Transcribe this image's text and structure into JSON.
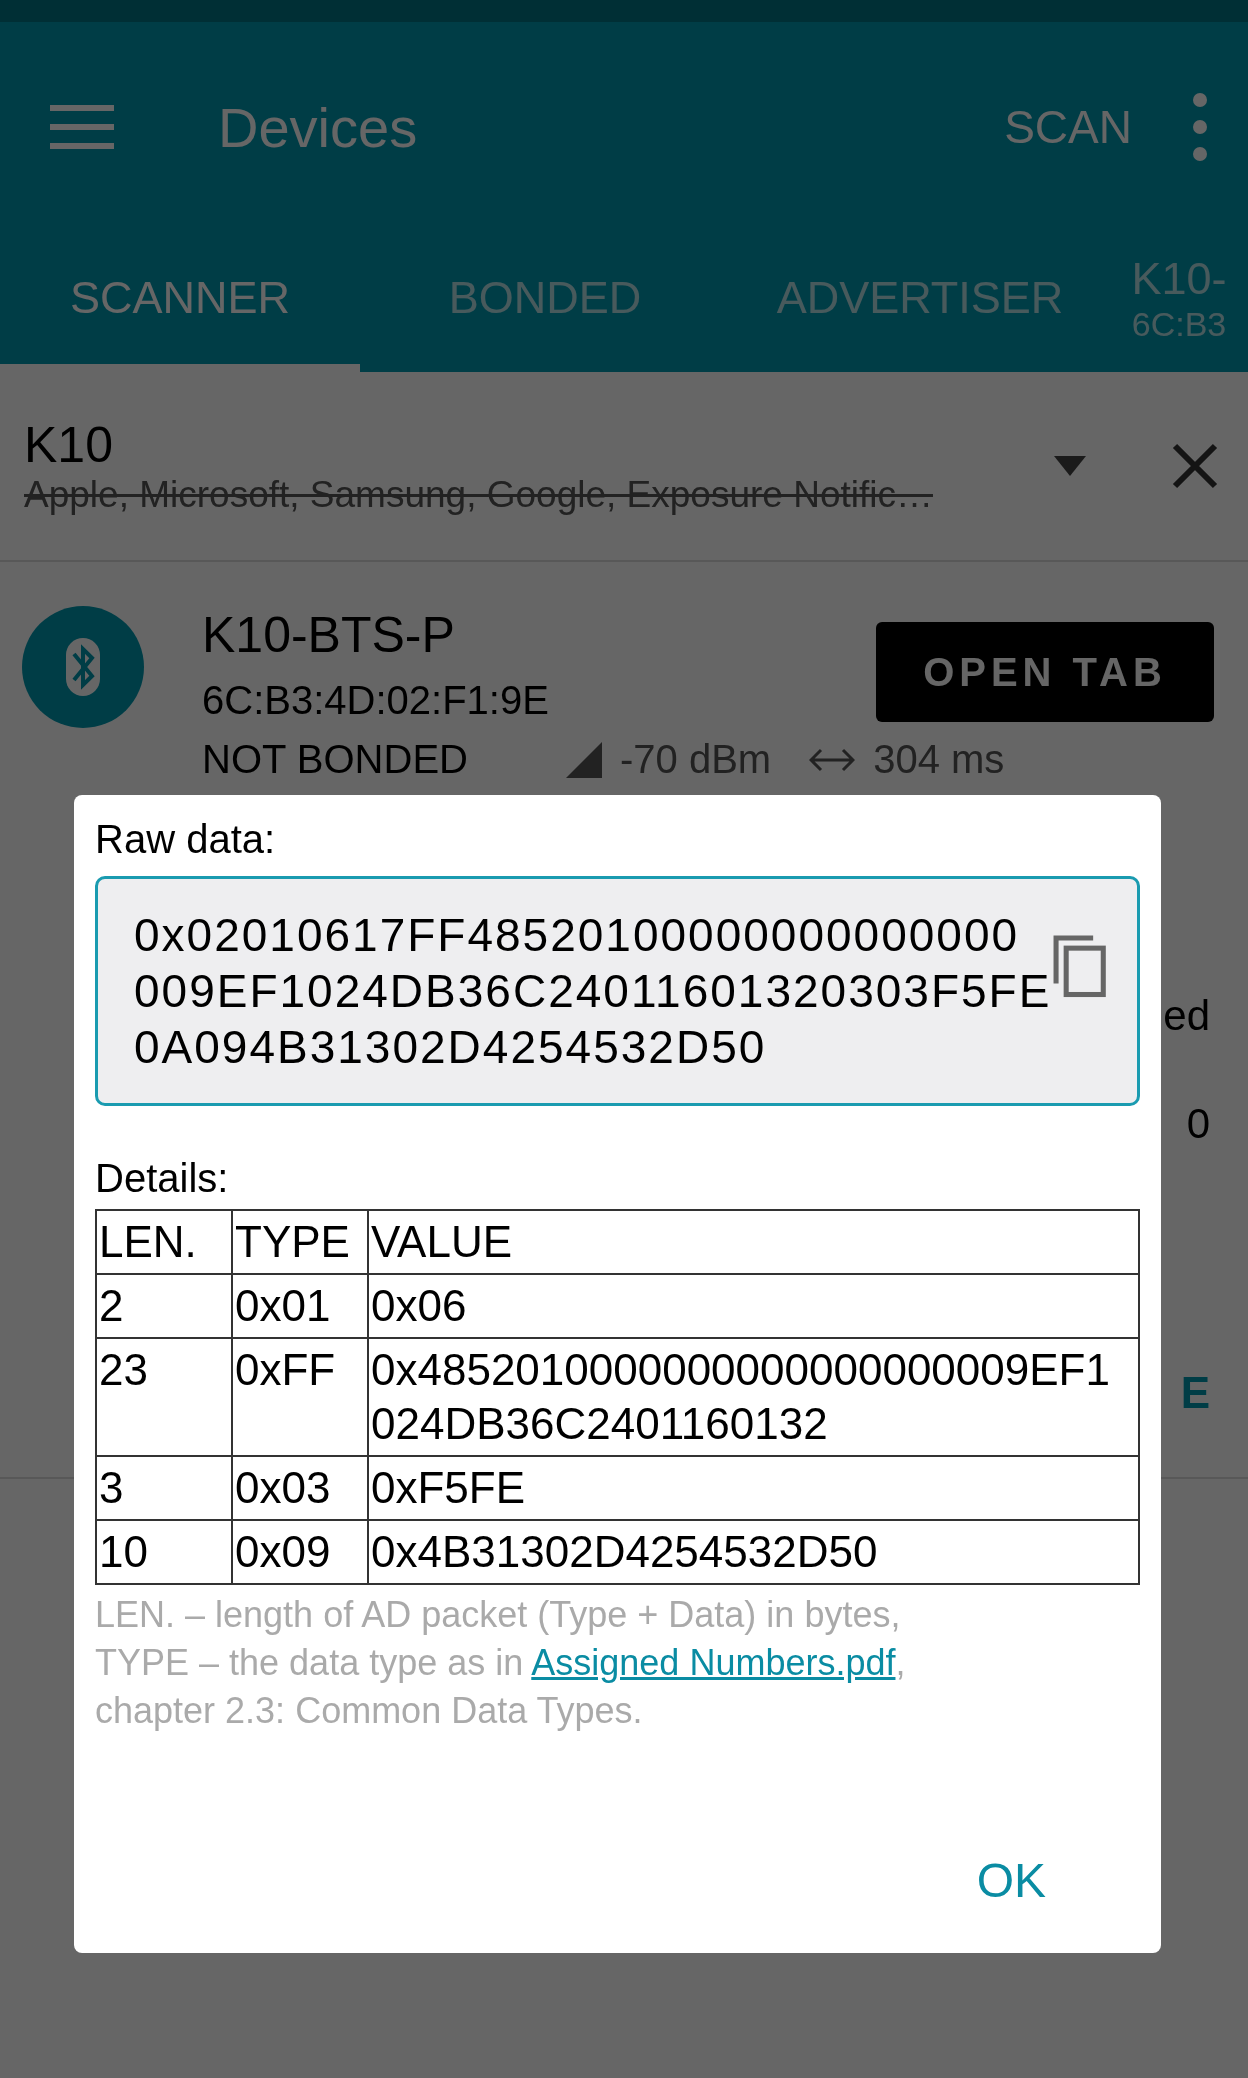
{
  "app_bar": {
    "title": "Devices",
    "action": "SCAN"
  },
  "tabs": [
    {
      "label": "SCANNER",
      "selected": true
    },
    {
      "label": "BONDED",
      "selected": false
    },
    {
      "label": "ADVERTISER",
      "selected": false
    },
    {
      "label": "K10-",
      "sublabel": "6C:B3",
      "selected": false
    }
  ],
  "filter": {
    "value": "K10",
    "excluded": "Apple, Microsoft, Samsung, Google, Exposure Notific…"
  },
  "device": {
    "name": "K10-BTS-P",
    "address": "6C:B3:4D:02:F1:9E",
    "bond_state": "NOT BONDED",
    "rssi": "-70 dBm",
    "interval": "304 ms",
    "button": "OPEN TAB",
    "partial_texts": [
      {
        "kind": "text",
        "text": "ed"
      },
      {
        "kind": "text",
        "text": "0"
      },
      {
        "kind": "action",
        "text": "E"
      }
    ]
  },
  "dialog": {
    "raw_label": "Raw data:",
    "raw_lines": [
      "0x02010617FF48520100000000000000",
      "009EF1024DB36C24011601320303F5FE",
      "0A094B31302D4254532D50"
    ],
    "details_label": "Details:",
    "columns": [
      "LEN.",
      "TYPE",
      "VALUE"
    ],
    "rows": [
      {
        "len": "2",
        "type": "0x01",
        "value": [
          "0x06"
        ]
      },
      {
        "len": "23",
        "type": "0xFF",
        "value": [
          "0x4852010000000000000000009EF1",
          "024DB36C2401160132"
        ]
      },
      {
        "len": "3",
        "type": "0x03",
        "value": [
          "0xF5FE"
        ]
      },
      {
        "len": "10",
        "type": "0x09",
        "value": [
          "0x4B31302D4254532D50"
        ]
      }
    ],
    "footnote": {
      "line_1": "LEN. – length of AD packet (Type + Data) in bytes,",
      "before_link": "TYPE – the data type as in ",
      "link": "Assigned Numbers.pdf",
      "after_link": ",",
      "line_3": "chapter 2.3: Common Data Types."
    },
    "ok": "OK"
  }
}
